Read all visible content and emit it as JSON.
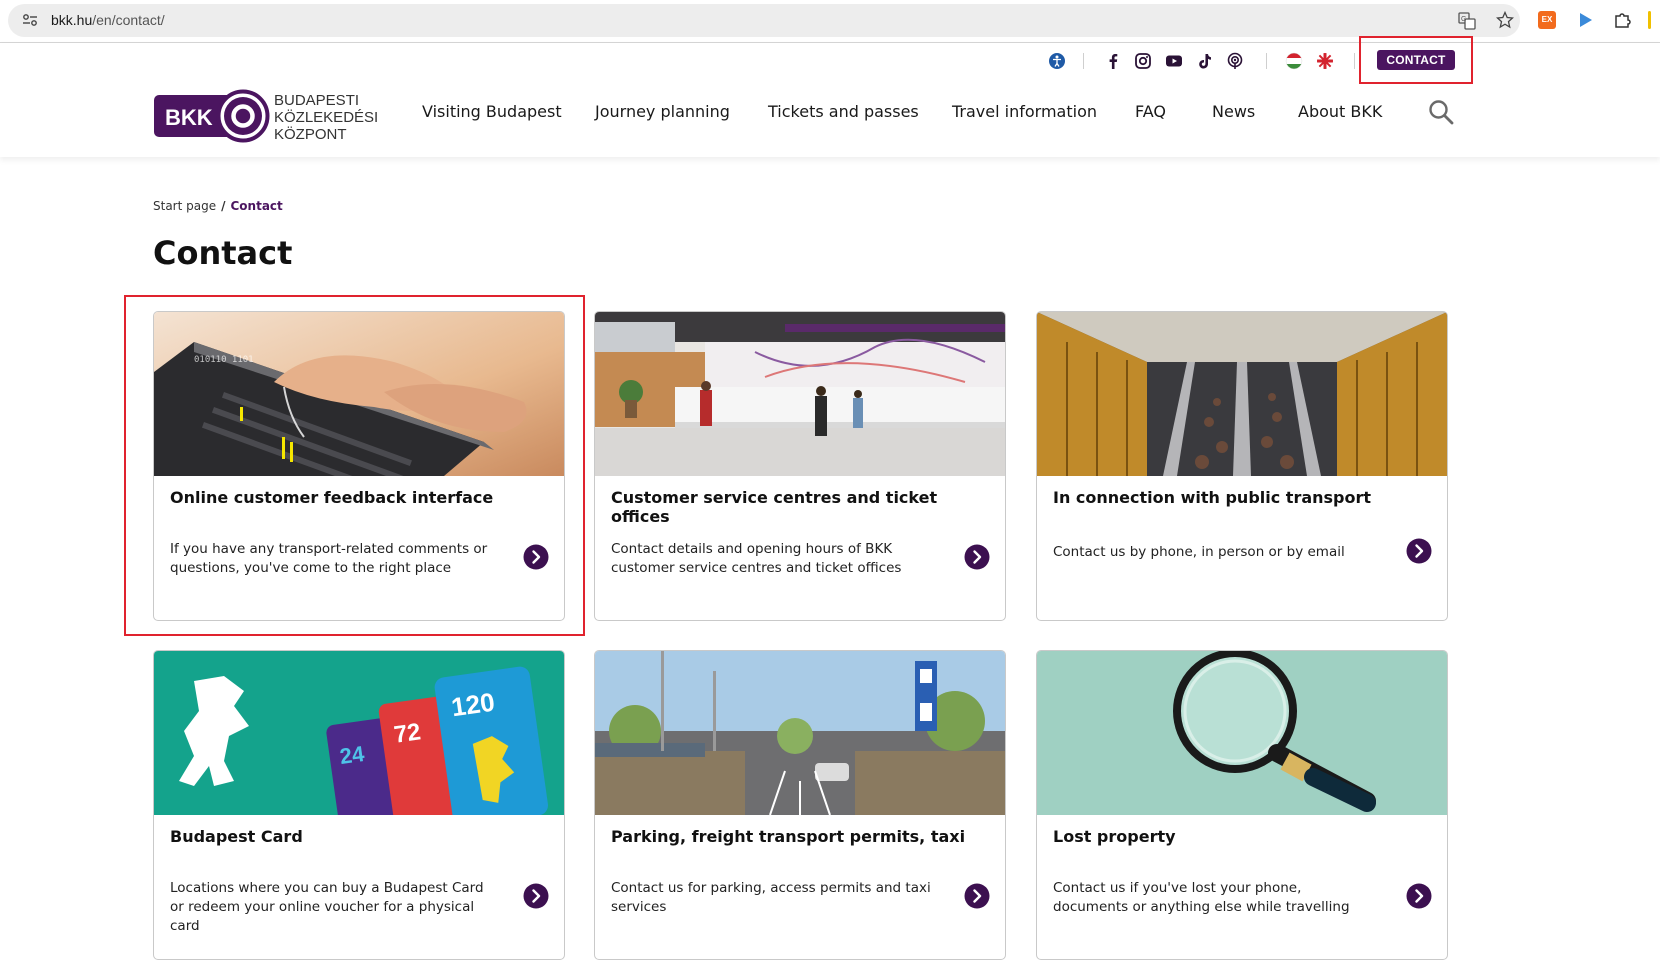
{
  "browser": {
    "url_host": "bkk.hu",
    "url_path": "/en/contact/",
    "ext1_label": "EX"
  },
  "header": {
    "logo_brand": "BKK",
    "logo_lines": [
      "BUDAPESTI",
      "KÖZLEKEDÉSI",
      "KÖZPONT"
    ],
    "contact_label": "CONTACT",
    "nav": [
      "Visiting Budapest",
      "Journey planning",
      "Tickets and passes",
      "Travel information",
      "FAQ",
      "News",
      "About BKK"
    ],
    "social_icons": [
      "accessibility-icon",
      "facebook-icon",
      "instagram-icon",
      "youtube-icon",
      "tiktok-icon",
      "podcast-icon",
      "hungarian-flag-icon",
      "uk-flag-icon"
    ]
  },
  "breadcrumb": {
    "home": "Start page",
    "separator": "/",
    "current": "Contact"
  },
  "page": {
    "title": "Contact"
  },
  "cards": [
    {
      "title": "Online customer feedback interface",
      "desc": "If you have any transport-related comments or questions, you've come to the right place",
      "image": "typing-hands-laptop"
    },
    {
      "title": "Customer service centres and ticket offices",
      "desc": "Contact details and opening hours of BKK customer service centres and ticket offices",
      "image": "ticket-office-counter"
    },
    {
      "title": "In connection with public transport",
      "desc": "Contact us by phone, in person or by email",
      "image": "metro-escalators"
    },
    {
      "title": "Budapest Card",
      "desc": "Locations where you can buy a Budapest Card or redeem your online voucher for a physical card",
      "image": "budapest-cards",
      "card_numbers": [
        "24",
        "72",
        "120"
      ]
    },
    {
      "title": "Parking, freight transport permits, taxi",
      "desc": "Contact us for parking, access permits and taxi services",
      "image": "parking-lot"
    },
    {
      "title": "Lost property",
      "desc": "Contact us if you've lost your phone, documents or anything else while travelling",
      "image": "magnifying-glass"
    }
  ],
  "colors": {
    "brand_purple": "#4b1560",
    "highlight_red": "#e0232e",
    "card_border": "#c9c9c9"
  }
}
